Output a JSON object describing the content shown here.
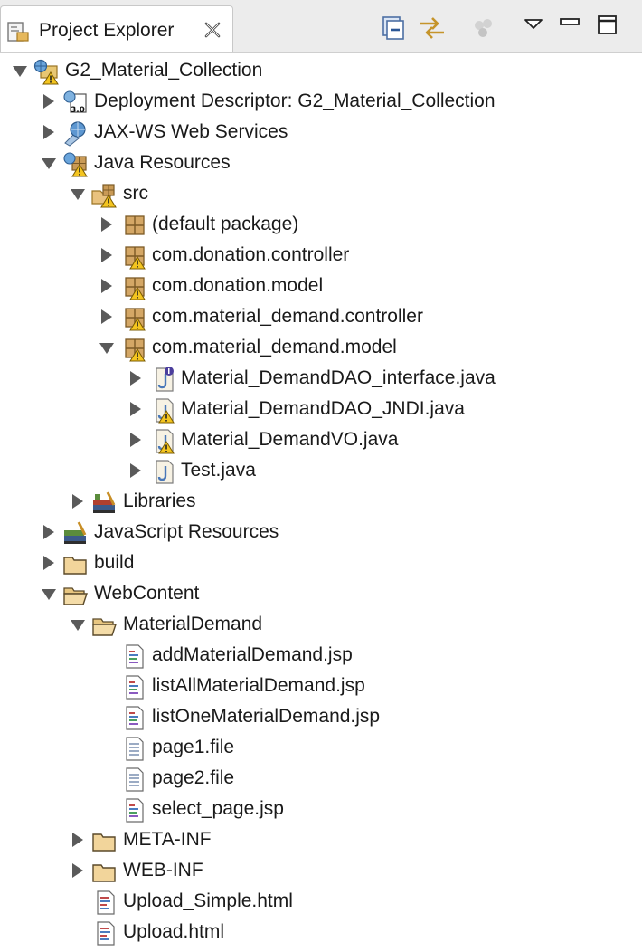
{
  "view": {
    "title": "Project Explorer",
    "toolbar": [
      {
        "icon": "collapse-all-icon"
      },
      {
        "icon": "link-with-editor-icon"
      },
      {
        "icon": "focus-on-active-task-icon"
      },
      {
        "icon": "view-menu-chevron-icon"
      },
      {
        "icon": "minimize-icon"
      },
      {
        "icon": "maximize-icon"
      }
    ]
  },
  "tree": [
    {
      "label": "G2_Material_Collection",
      "depth": 0,
      "state": "expanded",
      "icon": "web-project-icon",
      "warning": true
    },
    {
      "label": "Deployment Descriptor: G2_Material_Collection",
      "depth": 1,
      "state": "collapsed",
      "icon": "deployment-descriptor-icon",
      "warning": false
    },
    {
      "label": "JAX-WS Web Services",
      "depth": 1,
      "state": "collapsed",
      "icon": "web-services-icon",
      "warning": false
    },
    {
      "label": "Java Resources",
      "depth": 1,
      "state": "expanded",
      "icon": "java-resources-icon",
      "warning": true
    },
    {
      "label": "src",
      "depth": 2,
      "state": "expanded",
      "icon": "source-folder-icon",
      "warning": true
    },
    {
      "label": "(default package)",
      "depth": 3,
      "state": "collapsed",
      "icon": "package-icon",
      "warning": false
    },
    {
      "label": "com.donation.controller",
      "depth": 3,
      "state": "collapsed",
      "icon": "package-icon",
      "warning": true
    },
    {
      "label": "com.donation.model",
      "depth": 3,
      "state": "collapsed",
      "icon": "package-icon",
      "warning": true
    },
    {
      "label": "com.material_demand.controller",
      "depth": 3,
      "state": "collapsed",
      "icon": "package-icon",
      "warning": true
    },
    {
      "label": "com.material_demand.model",
      "depth": 3,
      "state": "expanded",
      "icon": "package-icon",
      "warning": true
    },
    {
      "label": "Material_DemandDAO_interface.java",
      "depth": 4,
      "state": "collapsed",
      "icon": "java-interface-file-icon",
      "warning": false
    },
    {
      "label": "Material_DemandDAO_JNDI.java",
      "depth": 4,
      "state": "collapsed",
      "icon": "java-file-icon",
      "warning": true
    },
    {
      "label": "Material_DemandVO.java",
      "depth": 4,
      "state": "collapsed",
      "icon": "java-file-icon",
      "warning": true
    },
    {
      "label": "Test.java",
      "depth": 4,
      "state": "collapsed",
      "icon": "java-file-icon",
      "warning": false
    },
    {
      "label": "Libraries",
      "depth": 2,
      "state": "collapsed",
      "icon": "libraries-icon",
      "warning": false
    },
    {
      "label": "JavaScript Resources",
      "depth": 1,
      "state": "collapsed",
      "icon": "javascript-resources-icon",
      "warning": false
    },
    {
      "label": "build",
      "depth": 1,
      "state": "collapsed",
      "icon": "folder-icon",
      "warning": false
    },
    {
      "label": "WebContent",
      "depth": 1,
      "state": "expanded",
      "icon": "folder-open-icon",
      "warning": false
    },
    {
      "label": "MaterialDemand",
      "depth": 2,
      "state": "expanded",
      "icon": "folder-open-icon",
      "warning": false
    },
    {
      "label": "addMaterialDemand.jsp",
      "depth": 3,
      "state": "leaf",
      "icon": "jsp-file-icon",
      "warning": false
    },
    {
      "label": "listAllMaterialDemand.jsp",
      "depth": 3,
      "state": "leaf",
      "icon": "jsp-file-icon",
      "warning": false
    },
    {
      "label": "listOneMaterialDemand.jsp",
      "depth": 3,
      "state": "leaf",
      "icon": "jsp-file-icon",
      "warning": false
    },
    {
      "label": "page1.file",
      "depth": 3,
      "state": "leaf",
      "icon": "text-file-icon",
      "warning": false
    },
    {
      "label": "page2.file",
      "depth": 3,
      "state": "leaf",
      "icon": "text-file-icon",
      "warning": false
    },
    {
      "label": "select_page.jsp",
      "depth": 3,
      "state": "leaf",
      "icon": "jsp-file-icon",
      "warning": false
    },
    {
      "label": "META-INF",
      "depth": 2,
      "state": "collapsed",
      "icon": "folder-icon",
      "warning": false
    },
    {
      "label": "WEB-INF",
      "depth": 2,
      "state": "collapsed",
      "icon": "folder-icon",
      "warning": false
    },
    {
      "label": "Upload_Simple.html",
      "depth": 2,
      "state": "leaf",
      "icon": "html-file-icon",
      "warning": false
    },
    {
      "label": "Upload.html",
      "depth": 2,
      "state": "leaf",
      "icon": "html-file-icon",
      "warning": false
    }
  ]
}
